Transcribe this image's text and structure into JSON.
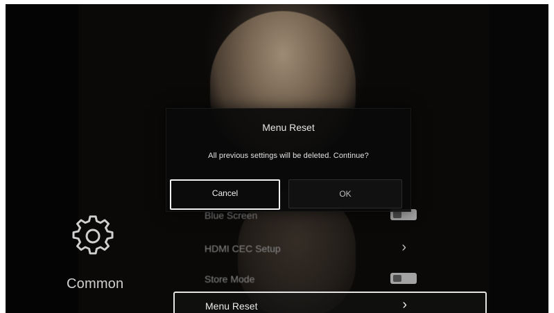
{
  "sidebar": {
    "category_label": "Common",
    "category_icon": "gear-icon"
  },
  "menu": {
    "items": [
      {
        "label": "Blue Screen",
        "control": "toggle-icon"
      },
      {
        "label": "HDMI CEC Setup",
        "control": "chevron-right-icon",
        "glyph": "›"
      },
      {
        "label": "Store Mode",
        "control": "toggle-icon"
      },
      {
        "label": "Menu Reset",
        "control": "chevron-right-icon",
        "glyph": "›"
      }
    ]
  },
  "dialog": {
    "title": "Menu Reset",
    "message": "All previous settings will be deleted. Continue?",
    "cancel_label": "Cancel",
    "ok_label": "OK"
  },
  "colors": {
    "screen_background": "#060606",
    "focus_border": "#f1f1f1",
    "text_primary": "#e5e5e5",
    "text_secondary": "#bdbdbd"
  }
}
